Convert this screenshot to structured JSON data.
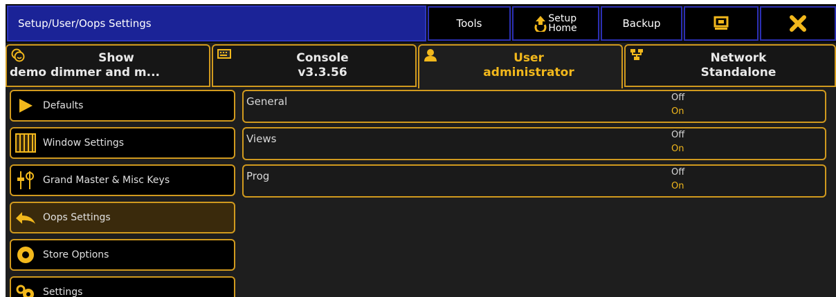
{
  "window": {
    "title": "Setup/User/Oops Settings"
  },
  "toolbar": {
    "tools_label": "Tools",
    "setup_home_line1": "Setup",
    "setup_home_line2": "Home",
    "backup_label": "Backup"
  },
  "tabs": [
    {
      "line1": "Show",
      "line2": "demo dimmer and m..."
    },
    {
      "line1": "Console",
      "line2": "v3.3.56"
    },
    {
      "line1": "User",
      "line2": "administrator"
    },
    {
      "line1": "Network",
      "line2": "Standalone"
    }
  ],
  "sidebar": {
    "items": [
      {
        "label": "Defaults"
      },
      {
        "label": "Window Settings"
      },
      {
        "label": "Grand Master & Misc Keys"
      },
      {
        "label": "Oops Settings"
      },
      {
        "label": "Store Options"
      },
      {
        "label": "Settings"
      }
    ]
  },
  "settings": {
    "rows": [
      {
        "name": "General",
        "off": "Off",
        "on": "On"
      },
      {
        "name": "Views",
        "off": "Off",
        "on": "On"
      },
      {
        "name": "Prog",
        "off": "Off",
        "on": "On"
      }
    ]
  },
  "colors": {
    "accent": "#f2b81c",
    "border": "#d19a1e",
    "title_bar": "#1b2397",
    "background": "#1e1e1e"
  },
  "icons": [
    "tools",
    "setup-home-icon",
    "monitor-icon",
    "close-icon",
    "smiley-icon",
    "console-icon",
    "user-icon",
    "network-icon",
    "play-icon",
    "window-grid-icon",
    "fader-icon",
    "undo-icon",
    "store-icon",
    "gears-icon"
  ]
}
